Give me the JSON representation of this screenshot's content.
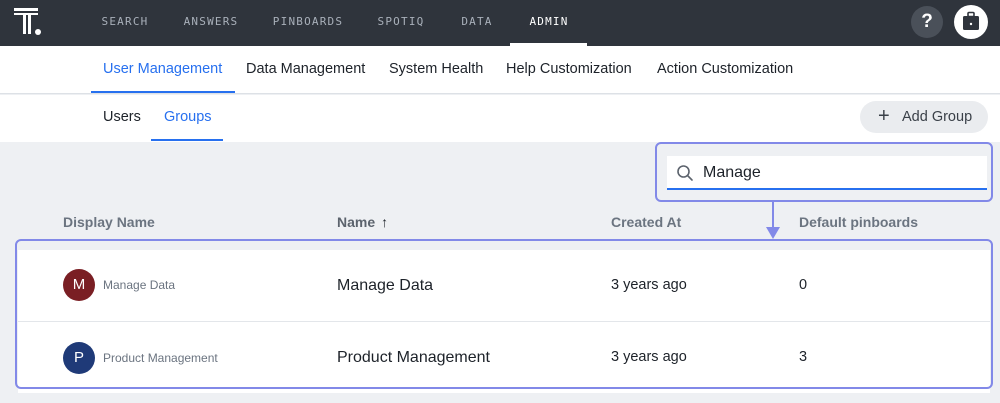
{
  "topnav": {
    "items": [
      {
        "label": "SEARCH"
      },
      {
        "label": "ANSWERS"
      },
      {
        "label": "PINBOARDS"
      },
      {
        "label": "SPOTIQ"
      },
      {
        "label": "DATA"
      },
      {
        "label": "ADMIN"
      }
    ],
    "active": "ADMIN",
    "help_label": "?"
  },
  "admin_tabs": [
    {
      "label": "User Management"
    },
    {
      "label": "Data Management"
    },
    {
      "label": "System Health"
    },
    {
      "label": "Help Customization"
    },
    {
      "label": "Action Customization"
    }
  ],
  "sub_tabs": [
    {
      "label": "Users"
    },
    {
      "label": "Groups"
    }
  ],
  "add_group_button": {
    "icon": "plus-icon",
    "label": "Add Group"
  },
  "search": {
    "value": "Manage"
  },
  "table": {
    "headers": [
      "Display Name",
      "Name",
      "Created At",
      "Default pinboards"
    ],
    "sort_icon": "↑",
    "rows": [
      {
        "avatar_letter": "M",
        "avatar_color": "#7a1f24",
        "display_name": "Manage Data",
        "name": "Manage Data",
        "created_at": "3 years ago",
        "pinboards": "0"
      },
      {
        "avatar_letter": "P",
        "avatar_color": "#1f3a78",
        "display_name": "Product Management",
        "name": "Product Management",
        "created_at": "3 years ago",
        "pinboards": "3"
      }
    ]
  },
  "colors": {
    "accent": "#2770ef",
    "nav_bg": "#2f343c",
    "highlight": "#8289e8"
  }
}
